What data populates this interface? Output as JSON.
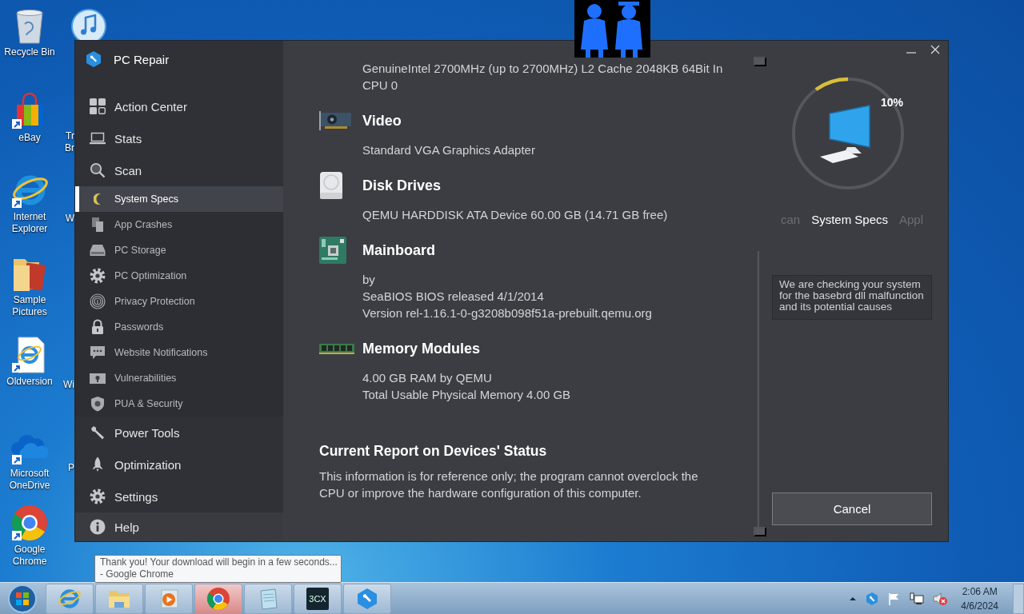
{
  "desktop_icons": [
    {
      "label": "Recycle Bin",
      "kind": "recycle"
    },
    {
      "label": "eBay",
      "kind": "bag"
    },
    {
      "label": "Internet Explorer",
      "kind": "ie"
    },
    {
      "label": "Sample Pictures",
      "kind": "folder"
    },
    {
      "label": "Oldversion",
      "kind": "document"
    },
    {
      "label": "Microsoft OneDrive",
      "kind": "cloud"
    },
    {
      "label": "Google Chrome",
      "kind": "chrome"
    }
  ],
  "desktop_icons_covered": [
    {
      "kind": "music"
    },
    {
      "kind": "generic",
      "lines": [
        "Tr",
        "Br"
      ]
    },
    {
      "kind": "generic",
      "lines": [
        "W"
      ]
    },
    {
      "kind": "generic",
      "lines": [
        "Wi"
      ]
    },
    {
      "kind": "generic",
      "lines": [
        "P"
      ]
    }
  ],
  "window": {
    "title": "PC Repair",
    "nav": [
      {
        "label": "Action Center",
        "kind": "main",
        "selected": false
      },
      {
        "label": "Stats",
        "kind": "main",
        "selected": false
      },
      {
        "label": "Scan",
        "kind": "main",
        "selected": false
      },
      {
        "label": "System Specs",
        "kind": "sub",
        "selected": true
      },
      {
        "label": "App Crashes",
        "kind": "sub",
        "selected": false
      },
      {
        "label": "PC Storage",
        "kind": "sub",
        "selected": false
      },
      {
        "label": "PC Optimization",
        "kind": "sub",
        "selected": false
      },
      {
        "label": "Privacy Protection",
        "kind": "sub",
        "selected": false
      },
      {
        "label": "Passwords",
        "kind": "sub",
        "selected": false
      },
      {
        "label": "Website Notifications",
        "kind": "sub",
        "selected": false
      },
      {
        "label": "Vulnerabilities",
        "kind": "sub",
        "selected": false
      },
      {
        "label": "PUA & Security",
        "kind": "sub",
        "selected": false
      },
      {
        "label": "Power Tools",
        "kind": "main",
        "selected": false
      },
      {
        "label": "Optimization",
        "kind": "main",
        "selected": false
      },
      {
        "label": "Settings",
        "kind": "main",
        "selected": false
      },
      {
        "label": "Help",
        "kind": "footer",
        "selected": false
      }
    ],
    "cpu_lines": [
      "GenuineIntel 2700MHz (up to 2700MHz) L2 Cache 2048KB 64Bit In",
      "CPU 0"
    ],
    "sections": [
      {
        "title": "Video",
        "lines": [
          "Standard VGA Graphics Adapter"
        ]
      },
      {
        "title": "Disk Drives",
        "lines": [
          "QEMU HARDDISK ATA Device 60.00 GB (14.71 GB free)"
        ]
      },
      {
        "title": "Mainboard",
        "lines": [
          "by",
          "SeaBIOS BIOS released 4/1/2014",
          "Version rel-1.16.1-0-g3208b098f51a-prebuilt.qemu.org"
        ]
      },
      {
        "title": "Memory Modules",
        "lines": [
          "4.00 GB RAM by QEMU",
          "Total Usable Physical Memory 4.00 GB"
        ]
      }
    ],
    "report": {
      "title": "Current Report on Devices' Status",
      "text": "This information is for reference only; the program cannot overclock the CPU or improve the hardware configuration of this computer."
    },
    "right_panel": {
      "progress": {
        "level": 0.1,
        "label": "10%"
      },
      "steps": [
        {
          "label": "can",
          "selected": false
        },
        {
          "label": "System Specs",
          "selected": true
        },
        {
          "label": "Appl",
          "selected": false
        }
      ],
      "info": "We are checking your system for the basebrd dll malfunction and its potential causes",
      "cancel_button": "Cancel"
    }
  },
  "tooltip": {
    "lines": [
      "Thank you! Your download will begin in a few seconds...",
      "- Google Chrome"
    ]
  },
  "taskbar": {
    "buttons": [
      {
        "kind": "ie",
        "selected": false
      },
      {
        "kind": "explorer",
        "selected": false
      },
      {
        "kind": "media",
        "selected": false
      },
      {
        "kind": "chrome",
        "selected": true
      },
      {
        "kind": "notepad",
        "selected": false
      },
      {
        "kind": "phone",
        "label": "3CX",
        "selected": false
      },
      {
        "kind": "repair",
        "selected": false
      }
    ],
    "time": "2:06 AM",
    "date": "4/6/2024"
  }
}
